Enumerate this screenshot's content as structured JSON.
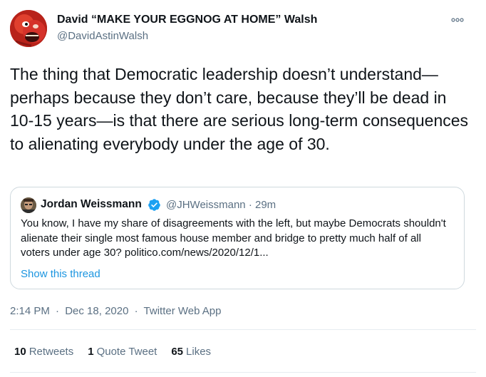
{
  "author": {
    "name": "David “MAKE YOUR EGGNOG AT HOME” Walsh",
    "handle": "@DavidAstinWalsh"
  },
  "tweet": {
    "text": "The thing that Democratic leadership doesn’t understand—perhaps because they don’t care, because they’ll be dead in 10-15 years—is that there are serious long-term consequences to alienating everybody under the age of 30."
  },
  "quote": {
    "name": "Jordan Weissmann",
    "handle": "@JHWeissmann",
    "separator": "·",
    "age": "29m",
    "text": "You know, I have my share of disagreements with the left, but maybe Democrats shouldn't alienate their single most famous house member and bridge to pretty much half of all voters under age 30? politico.com/news/2020/12/1...",
    "show_thread": "Show this thread"
  },
  "meta": {
    "time": "2:14 PM",
    "date": "Dec 18, 2020",
    "client": "Twitter Web App",
    "separator": "·"
  },
  "stats": {
    "retweets_count": "10",
    "retweets_label": "Retweets",
    "quotes_count": "1",
    "quotes_label": "Quote Tweet",
    "likes_count": "65",
    "likes_label": "Likes"
  },
  "icons": {
    "more": "more-horizontal-icon",
    "verified": "verified-badge-icon"
  },
  "colors": {
    "link": "#1b95e0",
    "secondary_text": "#5b7083",
    "border": "#cfd9de",
    "verified": "#1da1f2"
  }
}
